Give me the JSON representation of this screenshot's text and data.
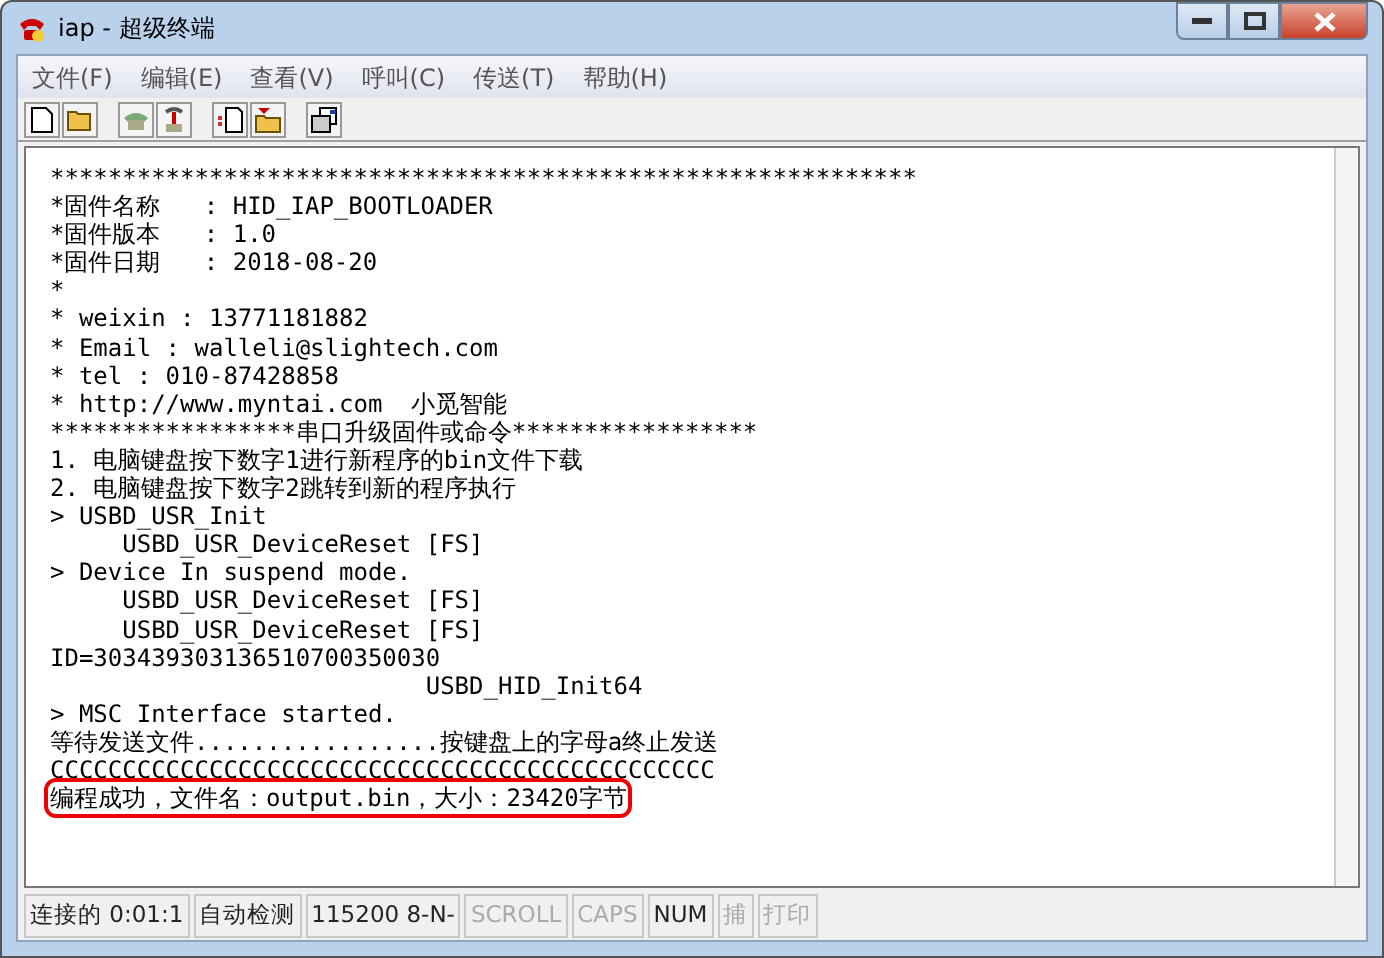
{
  "window": {
    "title": "iap - 超级终端"
  },
  "menu": [
    "文件(F)",
    "编辑(E)",
    "查看(V)",
    "呼叫(C)",
    "传送(T)",
    "帮助(H)"
  ],
  "terminal": {
    "lines": [
      {
        "text": "************************************************************",
        "highlighted": false
      },
      {
        "text": "*固件名称   : HID_IAP_BOOTLOADER",
        "highlighted": false
      },
      {
        "text": "*固件版本   : 1.0",
        "highlighted": false
      },
      {
        "text": "*固件日期   : 2018-08-20",
        "highlighted": false
      },
      {
        "text": "*",
        "highlighted": false
      },
      {
        "text": "* weixin : 13771181882",
        "highlighted": false
      },
      {
        "text": "* Email : walleli@slightech.com",
        "highlighted": false
      },
      {
        "text": "* tel : 010-87428858",
        "highlighted": false
      },
      {
        "text": "* http://www.myntai.com  小觅智能",
        "highlighted": false
      },
      {
        "text": "*****************串口升级固件或命令*****************",
        "highlighted": false
      },
      {
        "text": "1. 电脑键盘按下数字1进行新程序的bin文件下载",
        "highlighted": false
      },
      {
        "text": "2. 电脑键盘按下数字2跳转到新的程序执行",
        "highlighted": false
      },
      {
        "text": "> USBD_USR_Init",
        "highlighted": false
      },
      {
        "text": "     USBD_USR_DeviceReset [FS]",
        "highlighted": false
      },
      {
        "text": "> Device In suspend mode.",
        "highlighted": false
      },
      {
        "text": "     USBD_USR_DeviceReset [FS]",
        "highlighted": false
      },
      {
        "text": "     USBD_USR_DeviceReset [FS]",
        "highlighted": false
      },
      {
        "text": "ID=303439303136510700350030",
        "highlighted": false
      },
      {
        "text": "                          USBD_HID_Init64",
        "highlighted": false
      },
      {
        "text": "> MSC Interface started.",
        "highlighted": false
      },
      {
        "text": "等待发送文件.................按键盘上的字母a终止发送",
        "highlighted": false
      },
      {
        "text": "CCCCCCCCCCCCCCCCCCCCCCCCCCCCCCCCCCCCCCCCCCCCCC",
        "highlighted": false
      },
      {
        "text": "编程成功，文件名：output.bin，大小：23420字节",
        "highlighted": true
      }
    ]
  },
  "status_bar": [
    {
      "text": "连接的 0:01:1",
      "disabled": false
    },
    {
      "text": "自动检测",
      "disabled": false
    },
    {
      "text": "115200 8-N-",
      "disabled": false
    },
    {
      "text": "SCROLL",
      "disabled": true
    },
    {
      "text": "CAPS",
      "disabled": true
    },
    {
      "text": "NUM",
      "disabled": false
    },
    {
      "text": "捕",
      "disabled": true
    },
    {
      "text": "打印",
      "disabled": true
    }
  ]
}
